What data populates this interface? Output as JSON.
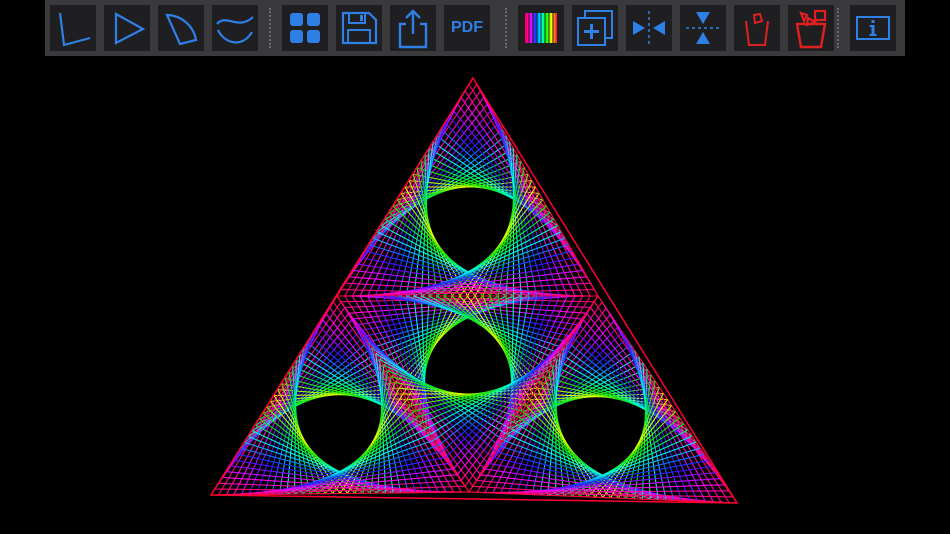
{
  "toolbar": {
    "buttons": [
      {
        "name": "angle-tool-icon"
      },
      {
        "name": "triangle-tool-icon"
      },
      {
        "name": "sector-tool-icon"
      },
      {
        "name": "curve-tool-icon"
      },
      {
        "name": "gallery-grid-icon"
      },
      {
        "name": "save-disk-icon"
      },
      {
        "name": "share-icon"
      },
      {
        "name": "pdf-export-icon",
        "label": "PDF"
      },
      {
        "name": "color-spectrum-icon"
      },
      {
        "name": "add-layer-icon"
      },
      {
        "name": "mirror-horizontal-icon"
      },
      {
        "name": "mirror-vertical-icon"
      },
      {
        "name": "delete-shape-icon"
      },
      {
        "name": "delete-all-icon"
      },
      {
        "name": "info-icon"
      }
    ],
    "accent_color": "#2f80e6",
    "danger_color": "#e02020"
  },
  "artwork": {
    "description_colors": [
      "#ff0040",
      "#ff00ff",
      "#0040ff",
      "#00ffff",
      "#00ff00",
      "#ffff00"
    ]
  }
}
